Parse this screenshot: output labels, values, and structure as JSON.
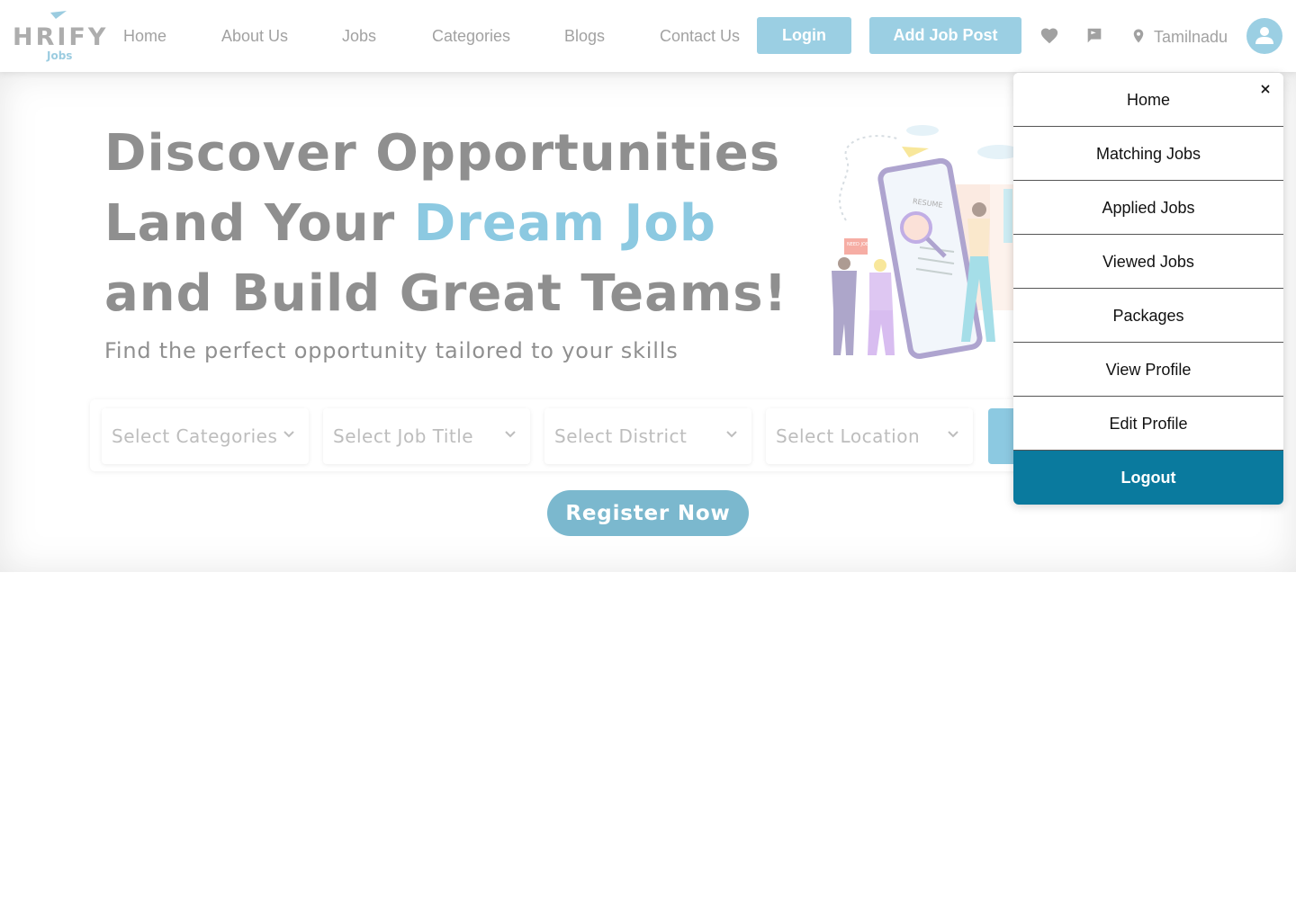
{
  "brand": {
    "name": "HRIFY",
    "sub": "Jobs"
  },
  "nav": {
    "links": [
      "Home",
      "About Us",
      "Jobs",
      "Categories",
      "Blogs",
      "Contact Us"
    ],
    "login_label": "Login",
    "add_job_label": "Add Job Post",
    "location": "Tamilnadu"
  },
  "hero": {
    "line1": "Discover Opportunities",
    "line2_prefix": "Land Your ",
    "line2_accent": "Dream Job",
    "line3": "and Build Great Teams!",
    "subtitle": "Find the perfect opportunity tailored to your skills",
    "illustration": {
      "resume_label": "RESUME",
      "sign_label": "NEED JOB"
    }
  },
  "search": {
    "selects": [
      {
        "label": "Select Categories"
      },
      {
        "label": "Select Job Title"
      },
      {
        "label": "Select District"
      },
      {
        "label": "Select Location"
      }
    ]
  },
  "register_label": "Register Now",
  "menu": {
    "items": [
      "Home",
      "Matching Jobs",
      "Applied Jobs",
      "Viewed Jobs",
      "Packages",
      "View Profile",
      "Edit Profile"
    ],
    "logout_label": "Logout",
    "close_symbol": "×"
  },
  "colors": {
    "accent": "#2e9dc9",
    "button": "#4aa8cc",
    "logout": "#0a7a9e",
    "register": "#0f7fa6"
  }
}
